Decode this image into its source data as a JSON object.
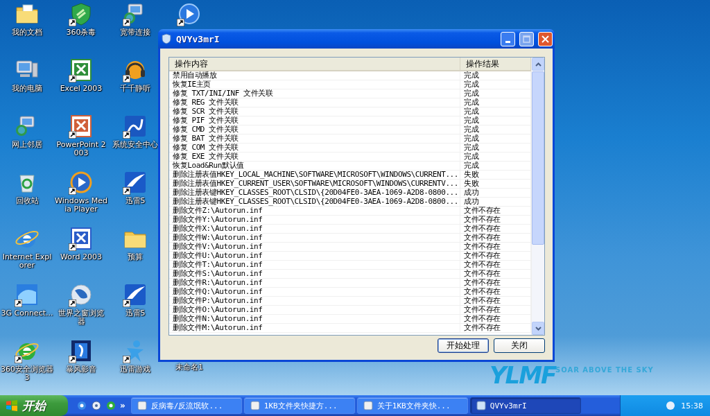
{
  "desktop": {
    "columns": [
      [
        {
          "label": "我的文档",
          "kind": "docs",
          "shortcut": false
        },
        {
          "label": "我的电脑",
          "kind": "computer",
          "shortcut": false
        },
        {
          "label": "网上邻居",
          "kind": "network",
          "shortcut": false
        },
        {
          "label": "回收站",
          "kind": "recycle",
          "shortcut": false
        },
        {
          "label": "Internet Explorer",
          "kind": "ie",
          "shortcut": false
        },
        {
          "label": "3G Connect...",
          "kind": "tile",
          "shortcut": true
        },
        {
          "label": "360安全浏览器 3",
          "kind": "ie-green",
          "shortcut": true
        }
      ],
      [
        {
          "label": "360杀毒",
          "kind": "shield",
          "shortcut": true
        },
        {
          "label": "Excel 2003",
          "kind": "excel",
          "shortcut": true
        },
        {
          "label": "PowerPoint 2003",
          "kind": "ppt",
          "shortcut": true
        },
        {
          "label": "Windows Media Player",
          "kind": "media",
          "shortcut": true
        },
        {
          "label": "Word 2003",
          "kind": "word",
          "shortcut": true
        },
        {
          "label": "世界之窗浏览器",
          "kind": "globe",
          "shortcut": true
        },
        {
          "label": "暴风影音",
          "kind": "film",
          "shortcut": true
        }
      ],
      [
        {
          "label": "宽带连接",
          "kind": "network",
          "shortcut": true
        },
        {
          "label": "千千静听",
          "kind": "headphones",
          "shortcut": true
        },
        {
          "label": "系统安全中心",
          "kind": "security",
          "shortcut": true
        },
        {
          "label": "迅雷5",
          "kind": "feather",
          "shortcut": true
        },
        {
          "label": "预算",
          "kind": "folder",
          "shortcut": false
        },
        {
          "label": "迅雷5",
          "kind": "feather",
          "shortcut": true
        },
        {
          "label": "迅雷游戏",
          "kind": "figure",
          "shortcut": true
        }
      ],
      [
        {
          "kind": "player",
          "shortcut": true
        },
        {
          "label": "未命名1",
          "kind": "hidden",
          "shortcut": false
        }
      ]
    ]
  },
  "wallpaper": {
    "logo": "YLMF",
    "slogan": "SOAR ABOVE THE SKY"
  },
  "window": {
    "title": "QVYv3mrI",
    "table": {
      "columns": [
        "操作内容",
        "操作结果"
      ],
      "rows": [
        [
          "禁用自动播放",
          "完成"
        ],
        [
          "恢复IE主页",
          "完成"
        ],
        [
          "修复 TXT/INI/INF 文件关联",
          "完成"
        ],
        [
          "修复 REG 文件关联",
          "完成"
        ],
        [
          "修复 SCR 文件关联",
          "完成"
        ],
        [
          "修复 PIF 文件关联",
          "完成"
        ],
        [
          "修复 CMD 文件关联",
          "完成"
        ],
        [
          "修复 BAT 文件关联",
          "完成"
        ],
        [
          "修复 COM 文件关联",
          "完成"
        ],
        [
          "修复 EXE 文件关联",
          "完成"
        ],
        [
          "恢复Load&Run默认值",
          "完成"
        ],
        [
          "删除注册表值HKEY_LOCAL_MACHINE\\SOFTWARE\\MICROSOFT\\WINDOWS\\CURRENT...",
          "失败"
        ],
        [
          "删除注册表值HKEY_CURRENT_USER\\SOFTWARE\\MICROSOFT\\WINDOWS\\CURRENTV...",
          "失败"
        ],
        [
          "删除注册表键HKEY_CLASSES_ROOT\\CLSID\\{20D04FE0-3AEA-1069-A2D8-0800...",
          "成功"
        ],
        [
          "删除注册表键HKEY_CLASSES_ROOT\\CLSID\\{20D04FE0-3AEA-1069-A2D8-0800...",
          "成功"
        ],
        [
          "删除文件Z:\\Autorun.inf",
          "文件不存在"
        ],
        [
          "删除文件Y:\\Autorun.inf",
          "文件不存在"
        ],
        [
          "删除文件X:\\Autorun.inf",
          "文件不存在"
        ],
        [
          "删除文件W:\\Autorun.inf",
          "文件不存在"
        ],
        [
          "删除文件V:\\Autorun.inf",
          "文件不存在"
        ],
        [
          "删除文件U:\\Autorun.inf",
          "文件不存在"
        ],
        [
          "删除文件T:\\Autorun.inf",
          "文件不存在"
        ],
        [
          "删除文件S:\\Autorun.inf",
          "文件不存在"
        ],
        [
          "删除文件R:\\Autorun.inf",
          "文件不存在"
        ],
        [
          "删除文件Q:\\Autorun.inf",
          "文件不存在"
        ],
        [
          "删除文件P:\\Autorun.inf",
          "文件不存在"
        ],
        [
          "删除文件O:\\Autorun.inf",
          "文件不存在"
        ],
        [
          "删除文件N:\\Autorun.inf",
          "文件不存在"
        ],
        [
          "删除文件M:\\Autorun.inf",
          "文件不存在"
        ]
      ]
    },
    "buttons": [
      "开始处理",
      "关闭"
    ]
  },
  "taskbar": {
    "start": "开始",
    "quick_launch_more": "»",
    "tasks": [
      {
        "label": "反病毒/反流氓软...",
        "selected": false
      },
      {
        "label": "1KB文件夹快捷方...",
        "selected": false
      },
      {
        "label": "关于1KB文件夹快...",
        "selected": false
      },
      {
        "label": "QVYv3mrI",
        "selected": true
      }
    ],
    "clock": "15:38"
  }
}
